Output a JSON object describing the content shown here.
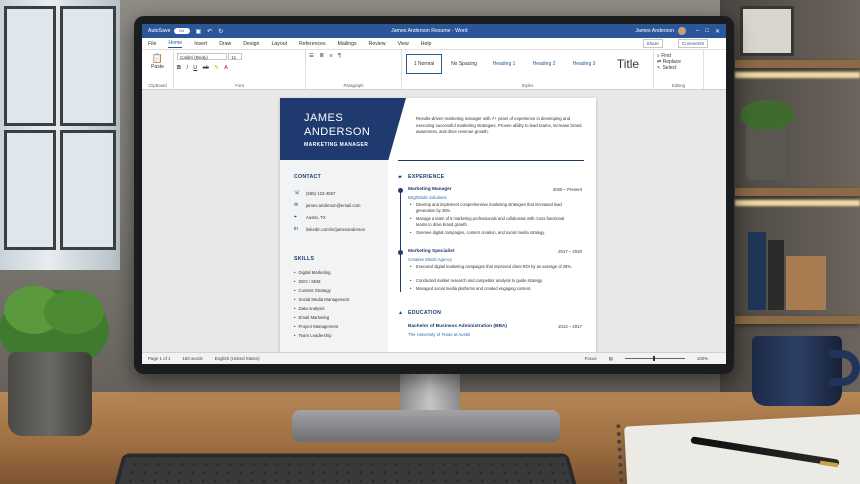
{
  "titlebar": {
    "autosave": "AutoSave",
    "autosave_state": "On",
    "doc_title": "James Anderson Resume - Word",
    "user": "James Anderson"
  },
  "menu": [
    "File",
    "Home",
    "Insert",
    "Draw",
    "Design",
    "Layout",
    "References",
    "Mailings",
    "Review",
    "View",
    "Help"
  ],
  "menu_right": {
    "share": "Share",
    "comments": "Comments"
  },
  "ribbon": {
    "paste": "Paste",
    "font_name": "Calibri (Body)",
    "font_size": "11",
    "groups": {
      "clipboard": "Clipboard",
      "font": "Font",
      "paragraph": "Paragraph",
      "styles": "Styles",
      "editing": "Editing"
    },
    "styles": [
      "1 Normal",
      "No Spacing",
      "Heading 1",
      "Heading 2",
      "Heading 3",
      "Title"
    ],
    "editing": [
      "Find",
      "Replace",
      "Select"
    ]
  },
  "status": {
    "page": "Page 1 of 1",
    "words": "150 words",
    "language": "English (United States)",
    "focus": "Focus",
    "zoom": "100%"
  },
  "resume": {
    "first_name": "JAMES",
    "last_name": "ANDERSON",
    "role": "MARKETING MANAGER",
    "summary": "Results-driven marketing manager with 7+ years of experience in developing and executing successful marketing strategies. Proven ability to lead teams, increase brand awareness, and drive revenue growth.",
    "contact_title": "CONTACT",
    "contact": [
      {
        "icon": "phone-icon",
        "glyph": "☏",
        "text": "(555) 123-4567"
      },
      {
        "icon": "mail-icon",
        "glyph": "✉",
        "text": "james.anderson@email.com"
      },
      {
        "icon": "location-icon",
        "glyph": "⌖",
        "text": "Austin, TX"
      },
      {
        "icon": "linkedin-icon",
        "glyph": "in",
        "text": "linkedin.com/in/jamesanderson"
      }
    ],
    "skills_title": "SKILLS",
    "skills": [
      "Digital Marketing",
      "SEO / SEM",
      "Content Strategy",
      "Social Media Management",
      "Data Analysis",
      "Email Marketing",
      "Project Management",
      "Team Leadership"
    ],
    "experience_title": "EXPERIENCE",
    "jobs": [
      {
        "title": "Marketing Manager",
        "date": "2020 – Present",
        "company": "BrightSide Solutions",
        "bullets": [
          "Develop and implement comprehensive marketing strategies that increased lead generation by 35%.",
          "Manage a team of 6 marketing professionals and collaborate with cross-functional teams to drive brand growth.",
          "Oversee digital campaigns, content creation, and social media strategy."
        ]
      },
      {
        "title": "Marketing Specialist",
        "date": "2017 – 2020",
        "company": "Creative Minds Agency",
        "bullets": [
          "Executed digital marketing campaigns that improved client ROI by an average of 28%.",
          "Conducted market research and competitor analysis to guide strategy.",
          "Managed social media platforms and created engaging content."
        ]
      }
    ],
    "education_title": "EDUCATION",
    "education": {
      "degree": "Bachelor of Business Administration (BBA)",
      "date": "2013 – 2017",
      "school": "The University of Texas at Austin"
    }
  }
}
